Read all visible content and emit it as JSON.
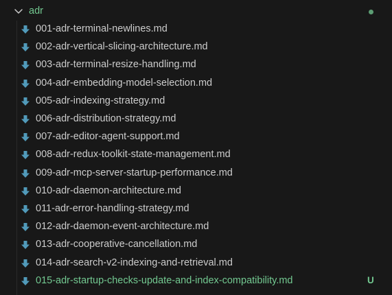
{
  "folder": {
    "name": "adr",
    "icon": "chevron-down-icon"
  },
  "files": [
    {
      "name": "001-adr-terminal-newlines.md",
      "status": ""
    },
    {
      "name": "002-adr-vertical-slicing-architecture.md",
      "status": ""
    },
    {
      "name": "003-adr-terminal-resize-handling.md",
      "status": ""
    },
    {
      "name": "004-adr-embedding-model-selection.md",
      "status": ""
    },
    {
      "name": "005-adr-indexing-strategy.md",
      "status": ""
    },
    {
      "name": "006-adr-distribution-strategy.md",
      "status": ""
    },
    {
      "name": "007-adr-editor-agent-support.md",
      "status": ""
    },
    {
      "name": "008-adr-redux-toolkit-state-management.md",
      "status": ""
    },
    {
      "name": "009-adr-mcp-server-startup-performance.md",
      "status": ""
    },
    {
      "name": "010-adr-daemon-architecture.md",
      "status": ""
    },
    {
      "name": "011-adr-error-handling-strategy.md",
      "status": ""
    },
    {
      "name": "012-adr-daemon-event-architecture.md",
      "status": ""
    },
    {
      "name": "013-adr-cooperative-cancellation.md",
      "status": ""
    },
    {
      "name": "014-adr-search-v2-indexing-and-retrieval.md",
      "status": ""
    },
    {
      "name": "015-adr-startup-checks-update-and-index-compatibility.md",
      "status": "U"
    }
  ],
  "colors": {
    "background": "#181818",
    "text": "#cccccc",
    "git_untracked": "#73c991",
    "markdown_icon": "#519aba"
  },
  "icons": {
    "file": "markdown-download-icon"
  }
}
